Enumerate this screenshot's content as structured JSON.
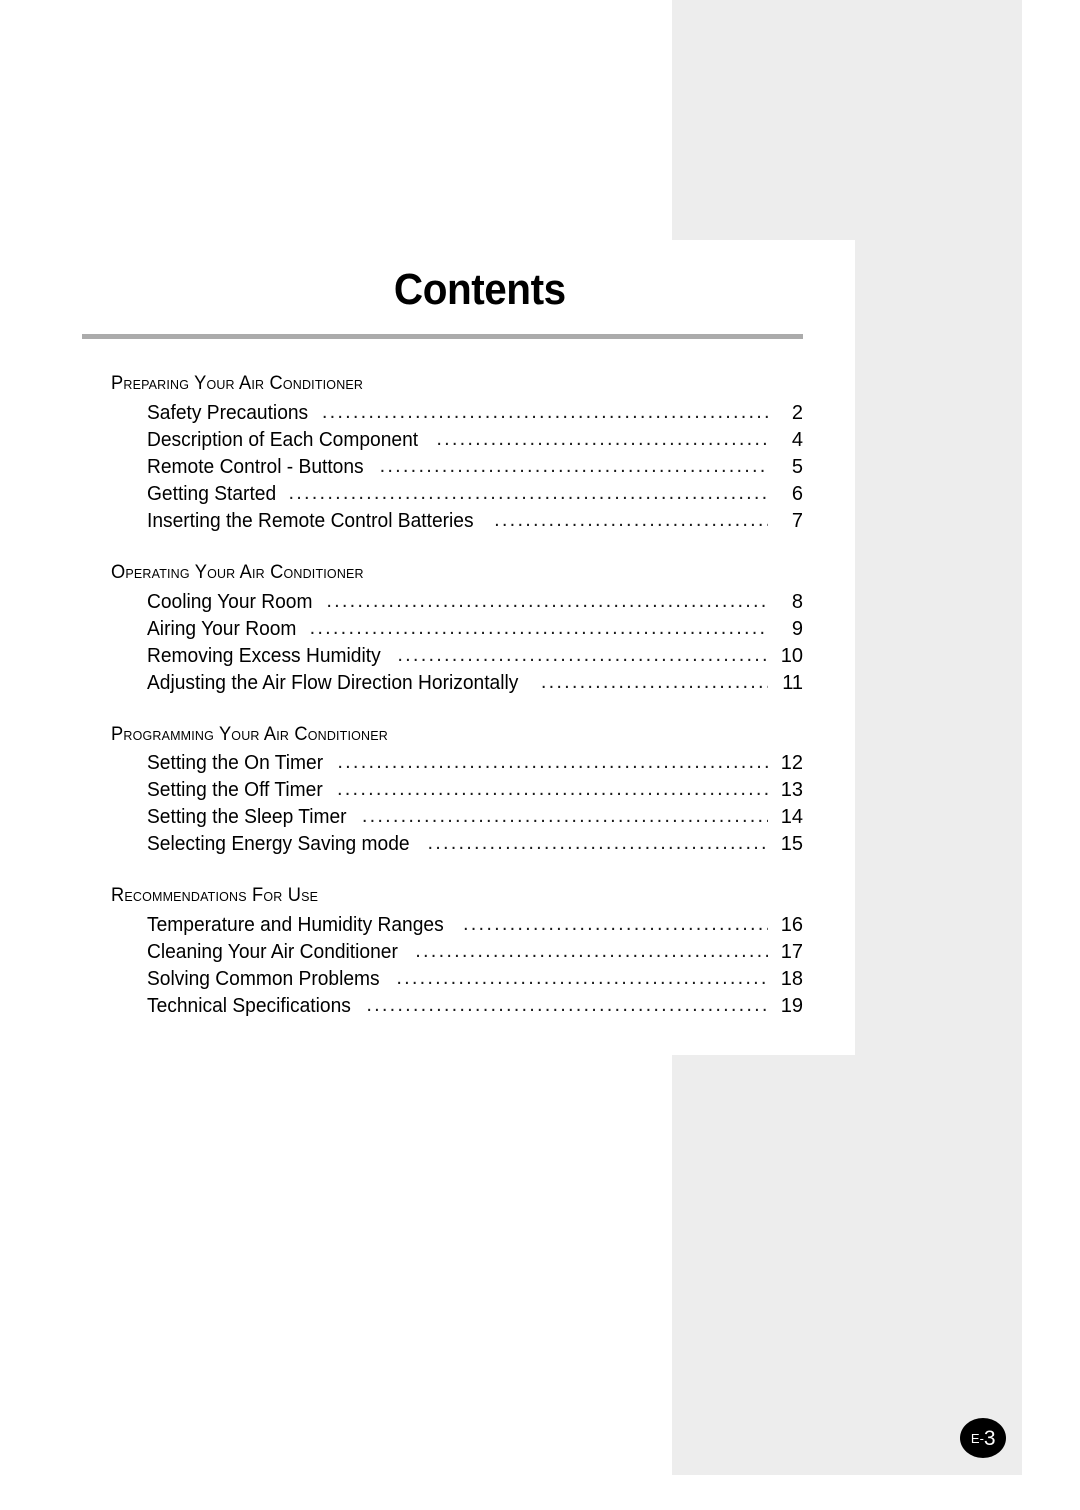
{
  "page": {
    "title": "Contents",
    "badge_prefix": "E-",
    "badge_number": "3",
    "rule_color": "#ababab",
    "panel_gray": "#ededed"
  },
  "sections": [
    {
      "title": "Preparing Your Air Conditioner",
      "entries": [
        {
          "label": "Safety Precautions",
          "leader": "............................................................................................",
          "page": "2"
        },
        {
          "label": "Description of Each Component",
          "leader": "............................................................................................",
          "page": "4"
        },
        {
          "label": "Remote Control - Buttons",
          "leader": "............................................................................................",
          "page": "5"
        },
        {
          "label": "Getting Started",
          "leader": "............................................................................................",
          "page": "6"
        },
        {
          "label": "Inserting the Remote Control Batteries",
          "leader": "............................................................................................",
          "page": "7"
        }
      ]
    },
    {
      "title": "Operating Your Air Conditioner",
      "entries": [
        {
          "label": "Cooling Your Room",
          "leader": "............................................................................................",
          "page": "8"
        },
        {
          "label": "Airing Your Room",
          "leader": "............................................................................................",
          "page": "9"
        },
        {
          "label": "Removing Excess Humidity",
          "leader": "............................................................................................",
          "page": "10"
        },
        {
          "label": "Adjusting the Air Flow Direction Horizontally",
          "leader": "............................................................................................",
          "page": "11"
        }
      ]
    },
    {
      "title": "Programming Your Air Conditioner",
      "entries": [
        {
          "label": "Setting the On Timer",
          "leader": "............................................................................................",
          "page": "12"
        },
        {
          "label": "Setting the Off Timer",
          "leader": "............................................................................................",
          "page": "13"
        },
        {
          "label": "Setting the Sleep Timer",
          "leader": "............................................................................................",
          "page": "14"
        },
        {
          "label": "Selecting Energy Saving mode",
          "leader": "............................................................................................",
          "page": "15"
        }
      ]
    },
    {
      "title": "Recommendations For Use",
      "entries": [
        {
          "label": "Temperature and Humidity Ranges",
          "leader": "............................................................................................",
          "page": "16"
        },
        {
          "label": "Cleaning Your Air Conditioner",
          "leader": "............................................................................................",
          "page": "17"
        },
        {
          "label": "Solving Common Problems",
          "leader": "............................................................................................",
          "page": "18"
        },
        {
          "label": "Technical Specifications",
          "leader": "............................................................................................",
          "page": "19"
        }
      ]
    }
  ]
}
